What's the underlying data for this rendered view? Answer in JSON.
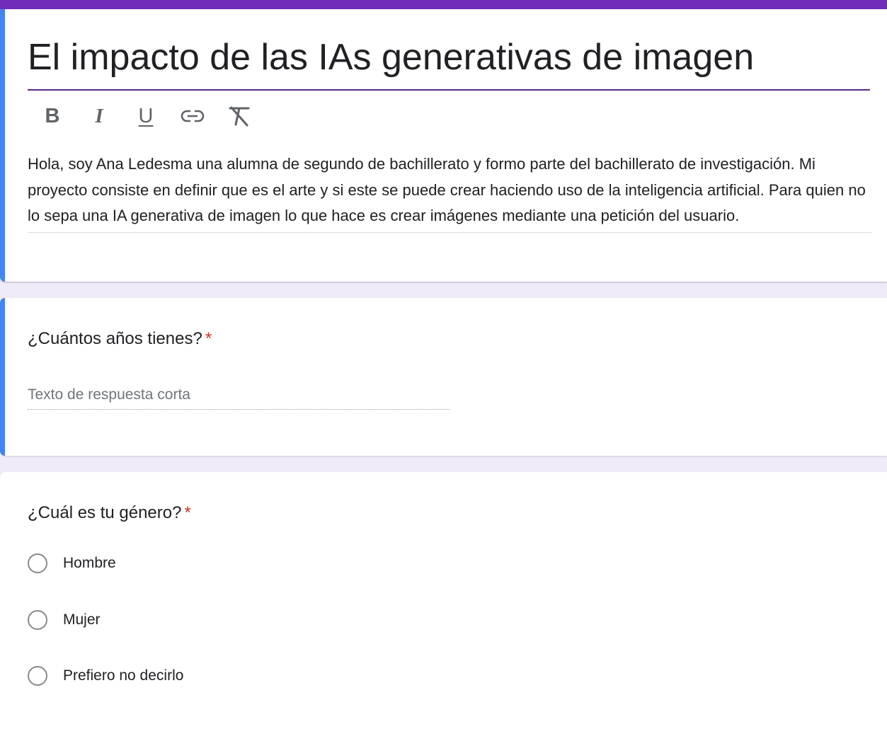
{
  "form": {
    "title": "El impacto de las IAs generativas de imagen",
    "description": "Hola, soy Ana Ledesma una alumna de segundo de bachillerato y formo parte del bachillerato de investigación. Mi proyecto consiste en definir que es el arte y si este se puede crear haciendo uso de la inteligencia artificial. Para quien no lo sepa una IA generativa de imagen lo que hace es crear imágenes mediante una petición del usuario.",
    "theme_color": "#673ab7",
    "active_accent": "#4285f4"
  },
  "toolbar": {
    "bold": "B",
    "italic": "I",
    "underline": "U",
    "link_icon": "link-icon",
    "clear_format_icon": "clear-format-icon"
  },
  "questions": [
    {
      "title": "¿Cuántos años tienes?",
      "required_mark": "*",
      "type": "short_answer",
      "placeholder": "Texto de respuesta corta"
    },
    {
      "title": "¿Cuál es tu género?",
      "required_mark": "*",
      "type": "multiple_choice",
      "options": [
        "Hombre",
        "Mujer",
        "Prefiero no decirlo"
      ]
    }
  ]
}
